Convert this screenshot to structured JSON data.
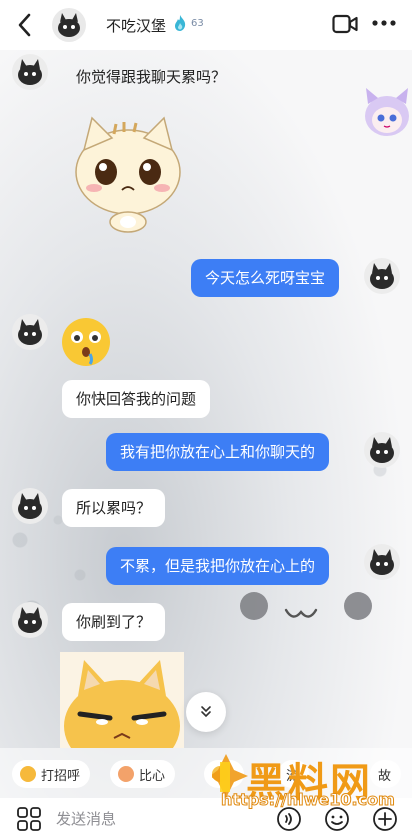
{
  "header": {
    "contact_name": "不吃汉堡",
    "flame_count": "63"
  },
  "messages": [
    {
      "side": "in",
      "text": "你觉得跟我聊天累吗？"
    },
    {
      "side": "in",
      "sticker": "crying-cat-sticker"
    },
    {
      "side": "out",
      "text": "今天怎么死呀宝宝"
    },
    {
      "side": "in",
      "sticker": "shocked-emoji-sticker"
    },
    {
      "side": "in",
      "text": "你快回答我的问题"
    },
    {
      "side": "out",
      "text": "我有把你放在心上和你聊天的"
    },
    {
      "side": "in",
      "text": "所以累吗？"
    },
    {
      "side": "out",
      "text": "不累，但是我把你放在心上的"
    },
    {
      "side": "in",
      "text": "你刷到了？"
    },
    {
      "side": "in",
      "sticker": "smirking-cat-sticker"
    }
  ],
  "quick_actions": [
    {
      "label": "打招呼",
      "icon": "wave-emoji-icon"
    },
    {
      "label": "比心",
      "icon": "heart-hands-emoji-icon"
    },
    {
      "label": "",
      "icon": "clapping-icon"
    },
    {
      "label": "流",
      "icon": ""
    },
    {
      "label": "故",
      "icon": ""
    }
  ],
  "composer": {
    "placeholder": "发送消息"
  },
  "watermark": {
    "title": "黑料网",
    "url": "https://hlwe10.com"
  },
  "colors": {
    "outgoing_bubble": "#3d7ef5",
    "incoming_bubble": "#ffffff",
    "flame": "#39b6d6",
    "watermark": "#f09a16"
  }
}
